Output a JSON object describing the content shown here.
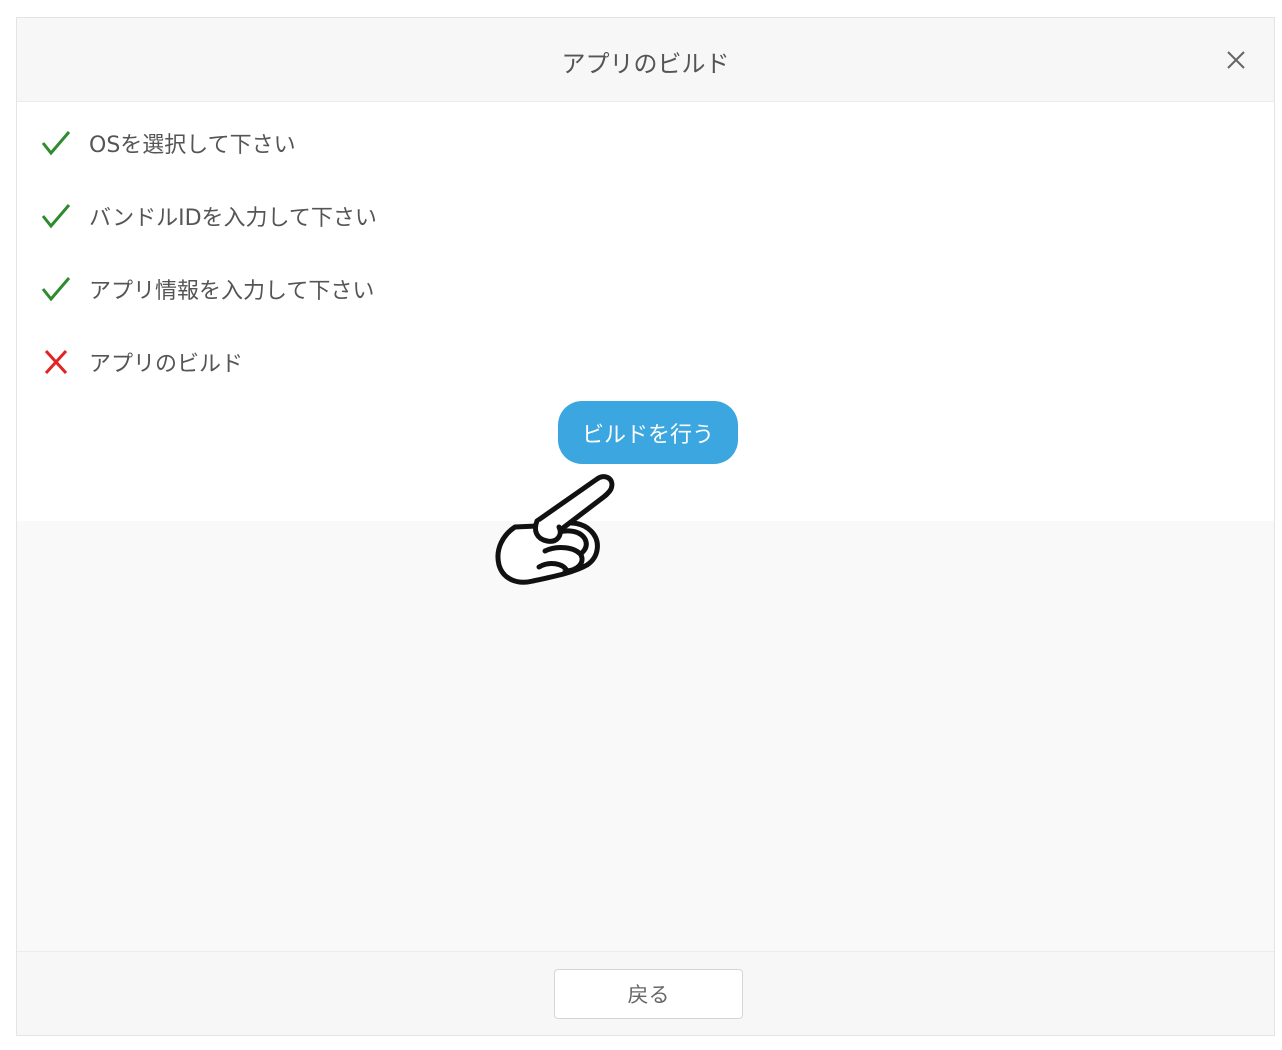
{
  "dialog": {
    "title": "アプリのビルド",
    "close_icon": "close-icon"
  },
  "steps": [
    {
      "label": "OSを選択して下さい",
      "status": "done",
      "icon": "check-icon",
      "color": "#2e8b2e"
    },
    {
      "label": "バンドルIDを入力して下さい",
      "status": "done",
      "icon": "check-icon",
      "color": "#2e8b2e"
    },
    {
      "label": "アプリ情報を入力して下さい",
      "status": "done",
      "icon": "check-icon",
      "color": "#2e8b2e"
    },
    {
      "label": "アプリのビルド",
      "status": "pending",
      "icon": "cross-icon",
      "color": "#e02424"
    }
  ],
  "build_button": {
    "label": "ビルドを行う",
    "color": "#3ba6e0"
  },
  "pointer": {
    "icon": "pointing-hand-icon"
  },
  "footer": {
    "back_label": "戻る"
  }
}
